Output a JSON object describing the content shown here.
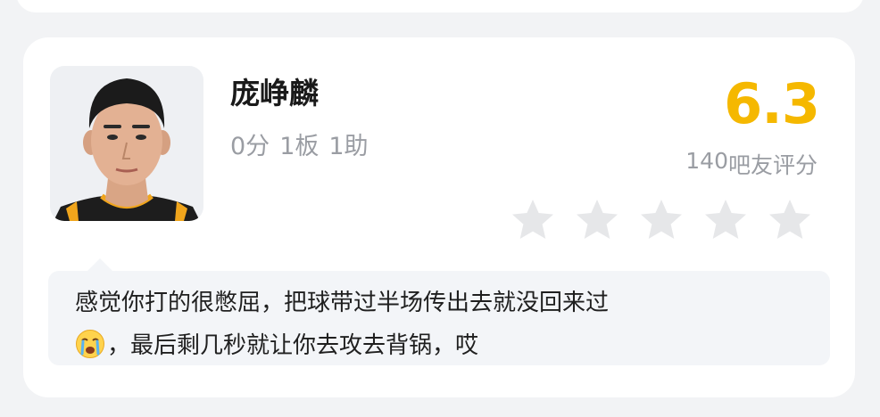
{
  "player": {
    "name": "庞峥麟",
    "stats": {
      "points": "0分",
      "rebounds": "1板",
      "assists": "1助"
    }
  },
  "rating": {
    "score": "6.3",
    "raters_count": "140",
    "raters_label": "吧友评分",
    "stars_filled": 0,
    "stars_total": 5,
    "score_color": "#f5b800",
    "star_color": "#e6e7e9"
  },
  "comment": {
    "line1": "感觉你打的很憋屈，把球带过半场传出去就没回来过",
    "emoji": "crying-face-icon",
    "line2": "，最后剩几秒就让你去攻去背锅，哎"
  }
}
